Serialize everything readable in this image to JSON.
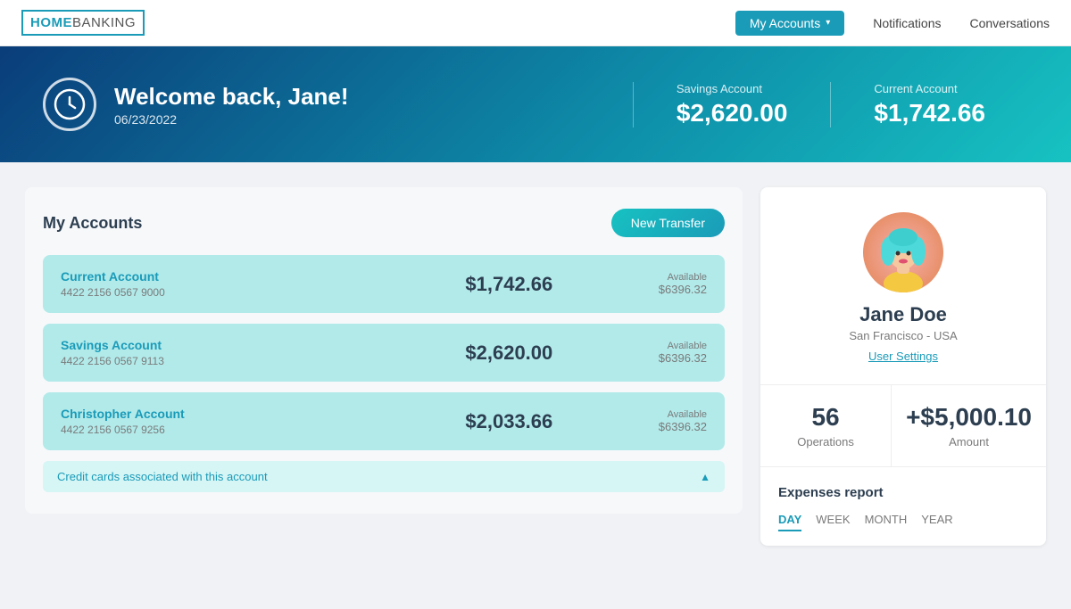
{
  "navbar": {
    "logo_home": "HOME",
    "logo_banking": "BANKING",
    "accounts_btn": "My Accounts",
    "notifications_link": "Notifications",
    "conversations_link": "Conversations"
  },
  "hero": {
    "greeting": "Welcome back, Jane!",
    "date": "06/23/2022",
    "savings_label": "Savings Account",
    "savings_amount": "$2,620.00",
    "current_label": "Current Account",
    "current_amount": "$1,742.66"
  },
  "accounts_panel": {
    "title": "My Accounts",
    "new_transfer_btn": "New Transfer",
    "accounts": [
      {
        "name": "Current Account",
        "number": "4422 2156 0567 9000",
        "amount": "$1,742.66",
        "available_label": "Available",
        "available_amount": "$6396.32"
      },
      {
        "name": "Savings Account",
        "number": "4422 2156 0567 9113",
        "amount": "$2,620.00",
        "available_label": "Available",
        "available_amount": "$6396.32"
      },
      {
        "name": "Christopher Account",
        "number": "4422 2156 0567 9256",
        "amount": "$2,033.66",
        "available_label": "Available",
        "available_amount": "$6396.32"
      }
    ],
    "credit_cards_text": "Credit cards associated with this account"
  },
  "profile": {
    "name": "Jane Doe",
    "location": "San Francisco - USA",
    "settings_link": "User Settings"
  },
  "stats": {
    "operations_count": "56",
    "operations_label": "Operations",
    "amount_value": "+$5,000.10",
    "amount_label": "Amount"
  },
  "expenses": {
    "title": "Expenses report",
    "tabs": [
      "DAY",
      "WEEK",
      "MONTH",
      "YEAR"
    ],
    "active_tab": "DAY"
  }
}
